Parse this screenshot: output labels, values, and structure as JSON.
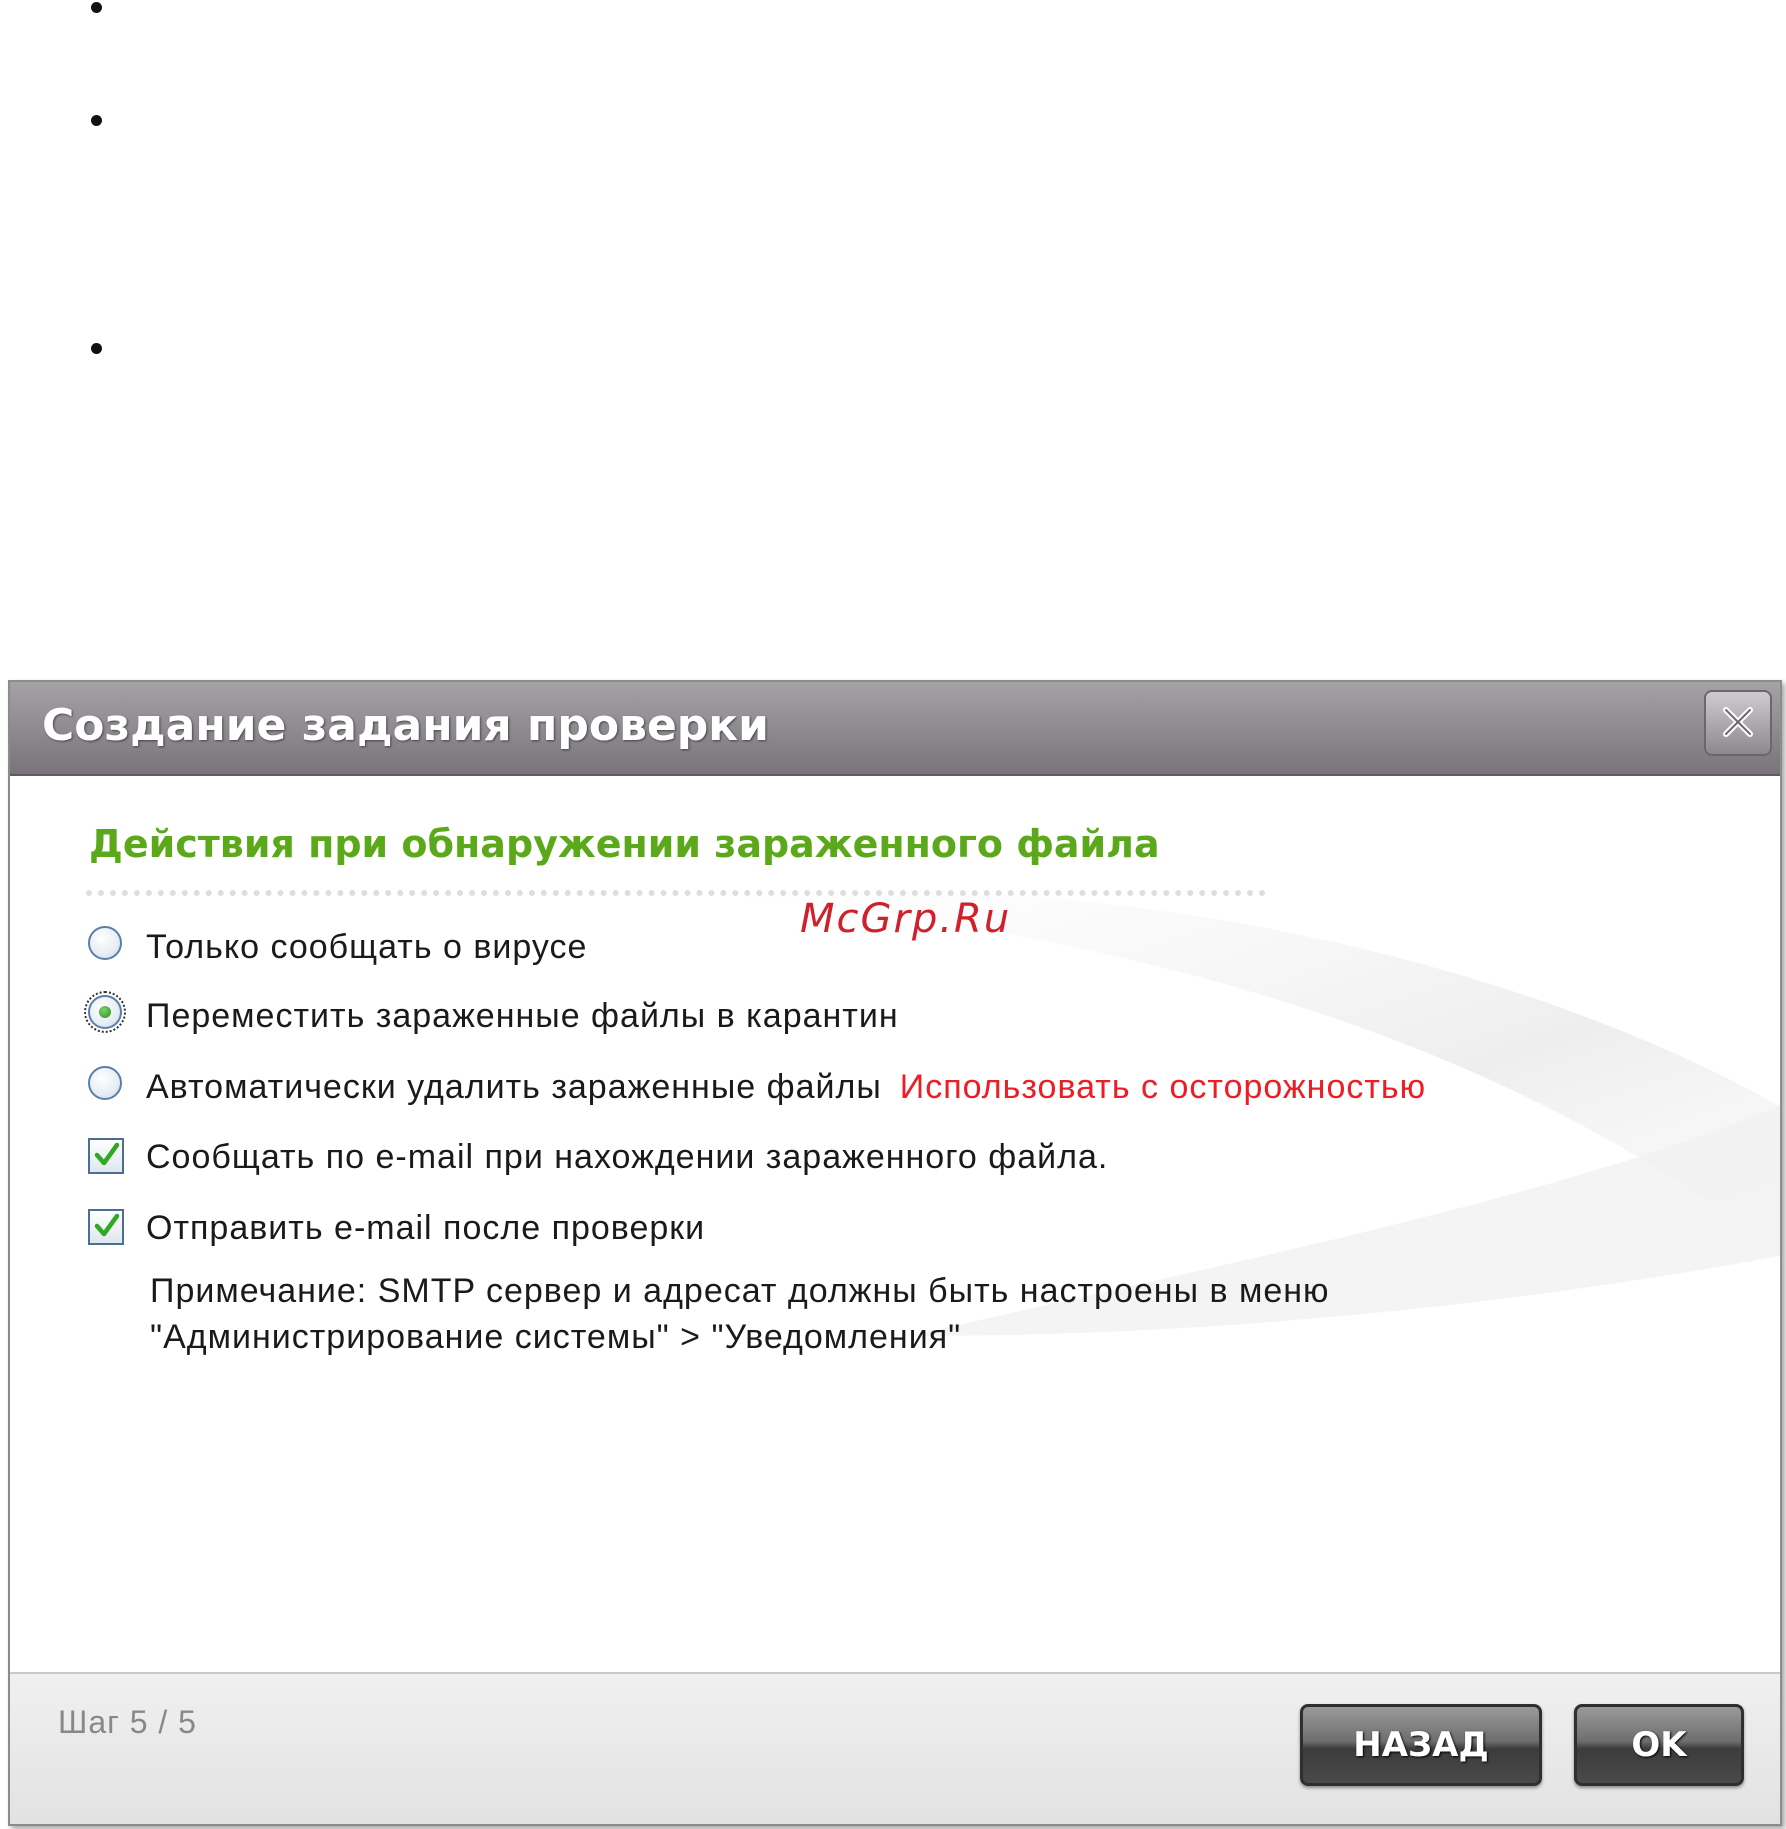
{
  "dialog": {
    "title": "Создание задания проверки",
    "section_title": "Действия при обнаружении зараженного файла",
    "watermark": "McGrp.Ru",
    "options": [
      {
        "type": "radio",
        "label": "Только сообщать о вирусе",
        "checked": false
      },
      {
        "type": "radio",
        "label": "Переместить зараженные файлы в карантин",
        "checked": true
      },
      {
        "type": "radio",
        "label": "Автоматически удалить зараженные файлы",
        "warning": "Использовать с осторожностью",
        "checked": false
      },
      {
        "type": "checkbox",
        "label": "Сообщать по e-mail при нахождении зараженного файла.",
        "checked": true
      },
      {
        "type": "checkbox",
        "label": "Отправить e-mail после проверки",
        "checked": true
      }
    ],
    "note_line1": "Примечание: SMTP сервер и адресат должны быть настроены в меню",
    "note_line2": "\"Администрирование системы\" > \"Уведомления\"",
    "step": "Шаг 5 / 5",
    "back_label": "НАЗАД",
    "ok_label": "OK"
  },
  "colors": {
    "section_title": "#5ba81a",
    "warning": "#ee1d24",
    "watermark": "#d0202a",
    "titlebar": "#8f8b91"
  },
  "icons": {
    "close": "close-x-icon",
    "check": "checkmark-icon"
  }
}
